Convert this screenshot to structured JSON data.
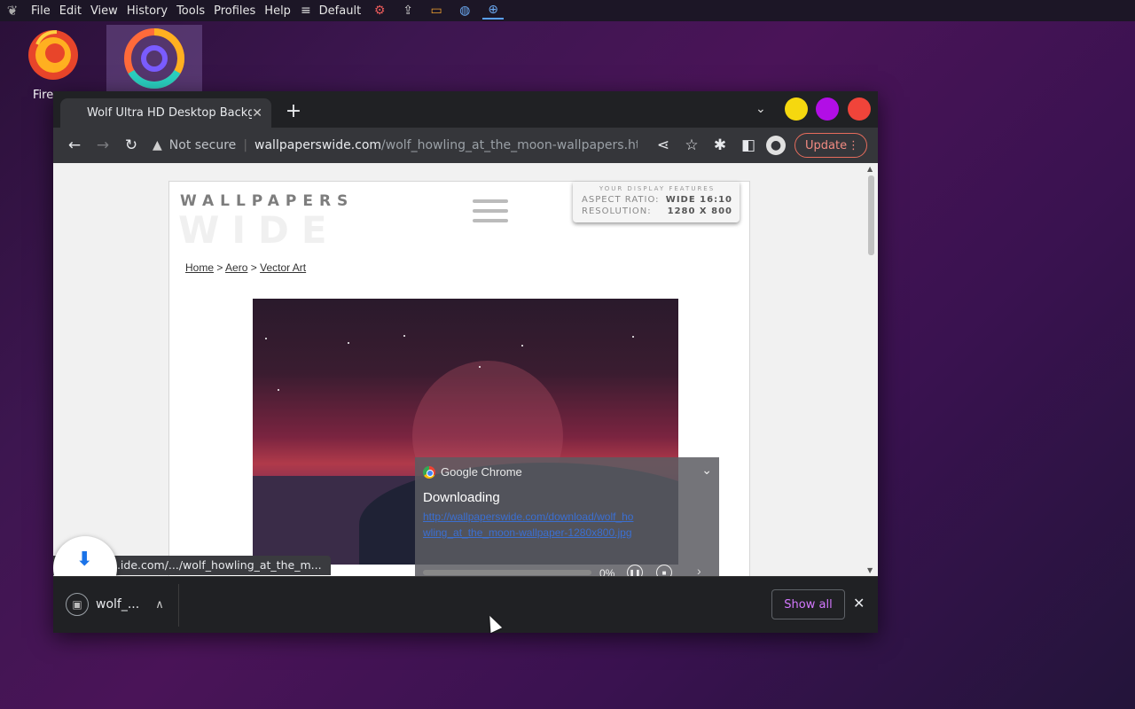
{
  "menubar": {
    "items": [
      "File",
      "Edit",
      "View",
      "History",
      "Tools",
      "Profiles",
      "Help"
    ],
    "profile_label": "Default",
    "tray_icons": [
      "settings-icon",
      "share-icon",
      "folder-icon",
      "globe-icon",
      "chrome-plus-icon"
    ]
  },
  "desktop": {
    "firefox_label": "Fire"
  },
  "browser": {
    "tab_title": "Wolf Ultra HD Desktop Background",
    "tab_close": "✕",
    "new_tab": "+",
    "security_text": "Not secure",
    "url_domain": "wallpaperswide.com",
    "url_path": "/wolf_howling_at_the_moon-wallpapers.ht...",
    "update_label": "Update",
    "window_colors": {
      "minimize": "#f5d80f",
      "maximize": "#b20ee6",
      "close": "#f0443a"
    }
  },
  "page": {
    "brand_top": "WALLPAPERS",
    "brand_bottom": "WIDE",
    "display_features": {
      "heading": "YOUR DISPLAY FEATURES",
      "aspect_label": "ASPECT RATIO:",
      "aspect_value": "WIDE 16:10",
      "resolution_label": "RESOLUTION:",
      "resolution_value": "1280 X 800"
    },
    "breadcrumb": [
      "Home",
      "Aero",
      "Vector Art"
    ],
    "breadcrumb_sep": ">"
  },
  "notification": {
    "app_name": "Google Chrome",
    "title": "Downloading",
    "link": "http://wallpaperswide.com/download/wolf_howling_at_the_moon-wallpaper-1280x800.jpg",
    "percent": "0%",
    "progress": 0
  },
  "status_tip": "...ide.com/.../wolf_howling_at_the_m...",
  "shelf": {
    "file_label": "wolf_...",
    "show_all": "Show all"
  }
}
